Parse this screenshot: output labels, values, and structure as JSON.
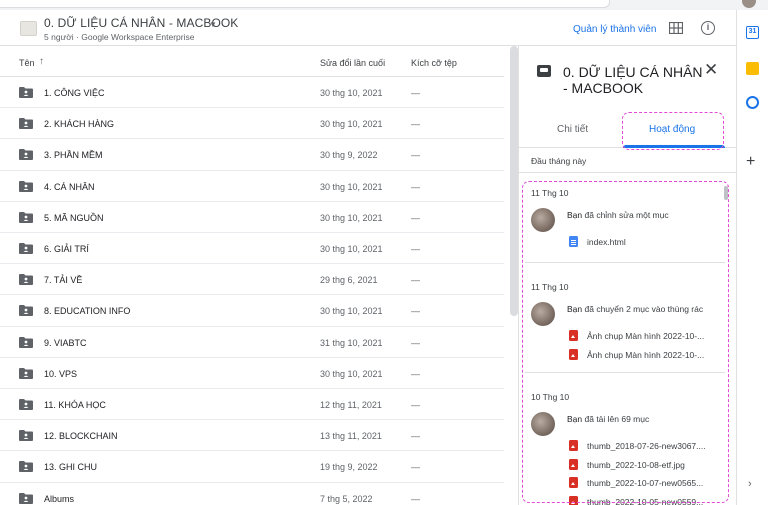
{
  "header": {
    "title": "0. DỮ LIỆU CÁ NHÂN - MACBOOK",
    "subtitle": "5 người · Google Workspace Enterprise",
    "manage_label": "Quản lý thành viên"
  },
  "list": {
    "col_name": "Tên",
    "col_modified": "Sửa đổi lần cuối",
    "col_size": "Kích cỡ tệp",
    "rows": [
      {
        "name": "1. CÔNG VIỆC",
        "modified": "30 thg 10, 2021",
        "size": "—"
      },
      {
        "name": "2. KHÁCH HÀNG",
        "modified": "30 thg 10, 2021",
        "size": "—"
      },
      {
        "name": "3. PHẦN MỀM",
        "modified": "30 thg 9, 2022",
        "size": "—"
      },
      {
        "name": "4. CÁ NHÂN",
        "modified": "30 thg 10, 2021",
        "size": "—"
      },
      {
        "name": "5. MÃ NGUỒN",
        "modified": "30 thg 10, 2021",
        "size": "—"
      },
      {
        "name": "6. GIẢI TRÍ",
        "modified": "30 thg 10, 2021",
        "size": "—"
      },
      {
        "name": "7. TẢI VỀ",
        "modified": "29 thg 6, 2021",
        "size": "—"
      },
      {
        "name": "8. EDUCATION INFO",
        "modified": "30 thg 10, 2021",
        "size": "—"
      },
      {
        "name": "9. VIABTC",
        "modified": "31 thg 10, 2021",
        "size": "—"
      },
      {
        "name": "10. VPS",
        "modified": "30 thg 10, 2021",
        "size": "—"
      },
      {
        "name": "11. KHÓA HỌC",
        "modified": "12 thg 11, 2021",
        "size": "—"
      },
      {
        "name": "12. BLOCKCHAIN",
        "modified": "13 thg 11, 2021",
        "size": "—"
      },
      {
        "name": "13. GHI CHU",
        "modified": "19 thg 9, 2022",
        "size": "—"
      },
      {
        "name": "Albums",
        "modified": "7 thg 5, 2022",
        "size": "—"
      }
    ]
  },
  "panel": {
    "title": "0. DỮ LIỆU CÁ NHÂN - MACBOOK",
    "tab_details": "Chi tiết",
    "tab_activity": "Hoạt động",
    "section_label": "Đầu tháng này",
    "groups": [
      {
        "date": "11 Thg 10",
        "actor": "Bạn",
        "action": "đã chỉnh sửa một mục",
        "files": [
          {
            "name": "index.html",
            "type": "doc"
          }
        ]
      },
      {
        "date": "11 Thg 10",
        "actor": "Bạn",
        "action": "đã chuyển 2 mục vào thùng rác",
        "files": [
          {
            "name": "Ảnh chụp Màn hình 2022-10-...",
            "type": "img"
          },
          {
            "name": "Ảnh chụp Màn hình 2022-10-...",
            "type": "img"
          }
        ]
      },
      {
        "date": "10 Thg 10",
        "actor": "Bạn",
        "action": "đã tải lên 69 mục",
        "files": [
          {
            "name": "thumb_2018-07-26-new3067....",
            "type": "img"
          },
          {
            "name": "thumb_2022-10-08-etf.jpg",
            "type": "img"
          },
          {
            "name": "thumb_2022-10-07-new0565...",
            "type": "img"
          },
          {
            "name": "thumb_2022-10-05-new0559...",
            "type": "img"
          }
        ]
      }
    ]
  },
  "icons": {
    "sort": "arrow-up-icon",
    "folder": "shared-folder-icon",
    "grid": "grid-view-icon",
    "info": "info-icon",
    "close": "close-icon",
    "panel_type": "shared-drive-icon",
    "calendar": "calendar-icon",
    "keep": "keep-icon",
    "tasks": "tasks-icon",
    "add": "plus-icon",
    "expand": "chevron-right-icon"
  },
  "colors": {
    "accent": "#1a73e8",
    "highlight": "#e04ad6"
  }
}
